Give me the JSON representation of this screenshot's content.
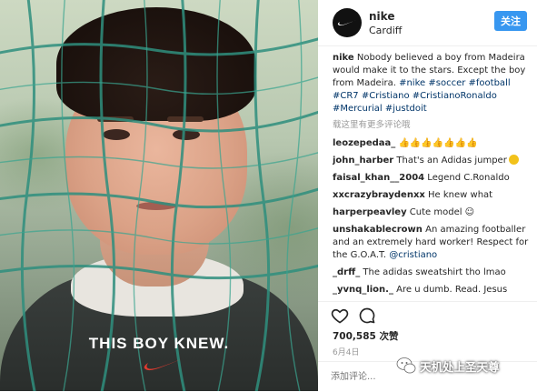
{
  "photo": {
    "slogan": "THIS BOY KNEW.",
    "swoosh_color": "#e03a2f"
  },
  "post": {
    "username": "nike",
    "location": "Cardiff",
    "follow_label": "关注",
    "caption_user": "nike",
    "caption_text": " Nobody believed a boy from Madeira would make it to the stars. Except the boy from Madeira. ",
    "hashtags": [
      "#nike",
      "#soccer",
      "#football",
      "#CR7",
      "#Cristiano",
      "#CristianoRonaldo",
      "#Mercurial",
      "#justdoit"
    ],
    "load_more": "载这里有更多评论哦",
    "comments": [
      {
        "user": "leozepedaa_",
        "text": " 👍👍👍👍👍👍👍"
      },
      {
        "user": "john_harber",
        "text": " That's an Adidas jumper"
      },
      {
        "user": "faisal_khan__2004",
        "text": " Legend C.Ronaldo"
      },
      {
        "user": "xxcrazybraydenxx",
        "text": " He knew what"
      },
      {
        "user": "harperpeavley",
        "text": " Cute model ☺"
      },
      {
        "user": "unshakablecrown",
        "text": " An amazing footballer and an extremely hard worker! Respect for the G.O.A.T. ",
        "mention": "@cristiano"
      },
      {
        "user": "_drff_",
        "text": " The adidas sweatshirt tho lmao"
      },
      {
        "user": "_yvnq_lion._",
        "text": " Are u dumb. Read. Jesus"
      }
    ],
    "likes": "700,585 次赞",
    "date": "6月4日",
    "comment_placeholder": "添加评论...",
    "icons": {
      "like": "heart-icon",
      "comment": "comment-bubble-icon"
    }
  },
  "watermark": {
    "text": "天机处上圣天尊"
  },
  "colors": {
    "accent": "#3897f0",
    "hashtag": "#003569",
    "muted": "#999999"
  }
}
